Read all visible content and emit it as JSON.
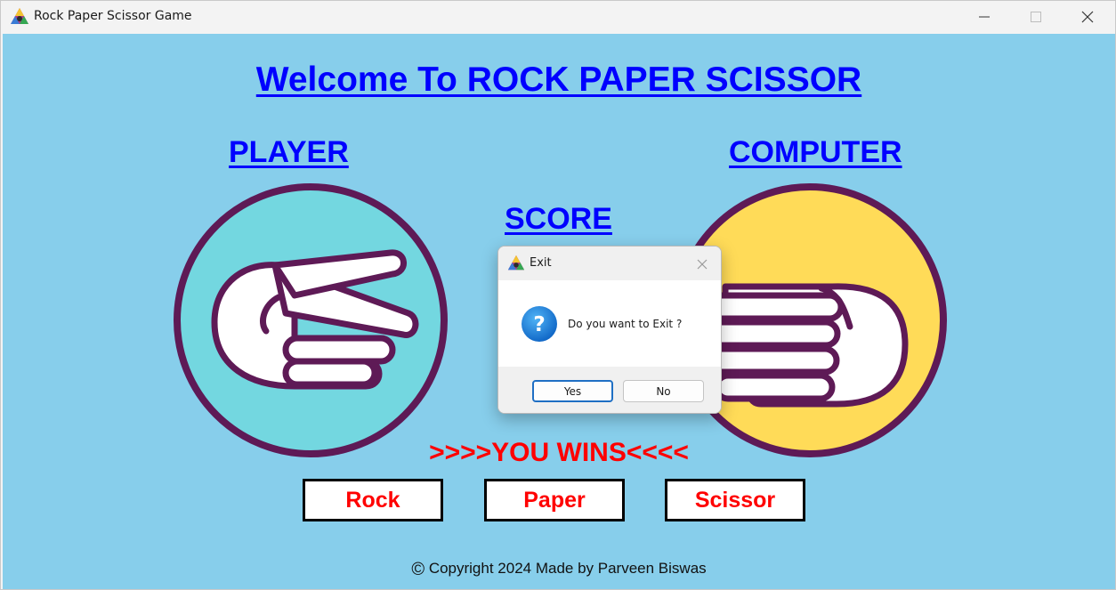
{
  "window": {
    "title": "Rock Paper Scissor Game"
  },
  "game": {
    "welcome_title": "Welcome To ROCK PAPER SCISSOR",
    "player_label": "PLAYER",
    "computer_label": "COMPUTER",
    "score_label": "SCORE",
    "result_text": ">>>>YOU WINS<<<<",
    "player_choice": "scissor-hand",
    "computer_choice": "paper-hand",
    "buttons": {
      "rock": "Rock",
      "paper": "Paper",
      "scissor": "Scissor"
    },
    "footer": "Copyright 2024 Made by Parveen Biswas"
  },
  "dialog": {
    "title": "Exit",
    "message": "Do you want to Exit ?",
    "yes_label": "Yes",
    "no_label": "No",
    "icon": "question-icon"
  },
  "colors": {
    "background": "#87ceeb",
    "heading": "#0000ff",
    "result": "#ff0000",
    "player_circle": "#73d7e0",
    "computer_circle": "#ffdb58",
    "circle_outline": "#5e1a56"
  }
}
